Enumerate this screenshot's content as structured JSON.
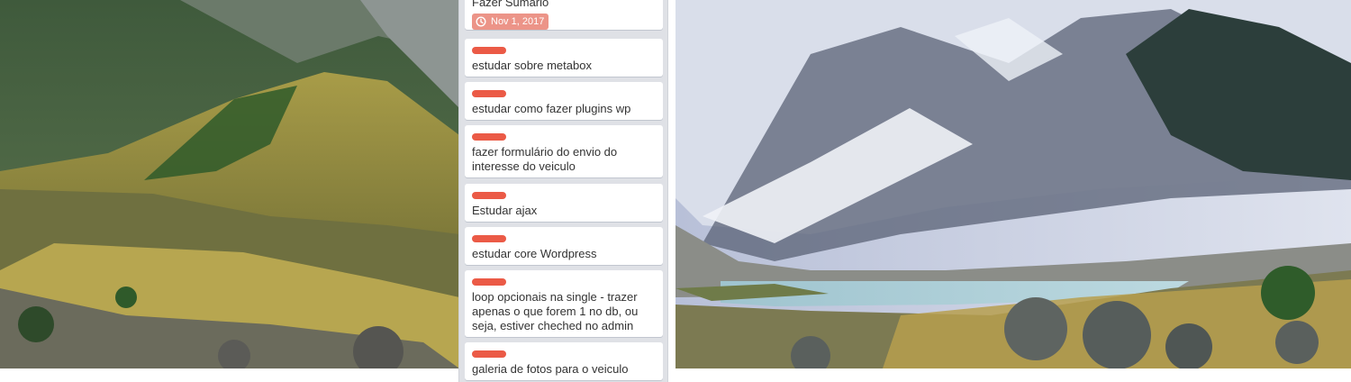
{
  "board": {
    "background": "mountain-lake-photo",
    "accent_label_color": "#eb5a46",
    "due_badge_color": "#ec9488"
  },
  "list": {
    "cards": [
      {
        "title": "Fazer Sumário",
        "label_color": "",
        "due": "Nov 1, 2017",
        "due_icon": "clock-icon"
      },
      {
        "title": "estudar sobre metabox",
        "label_color": "red"
      },
      {
        "title": "estudar como fazer plugins wp",
        "label_color": "red"
      },
      {
        "title": "fazer formulário do envio do interesse do veiculo",
        "label_color": "red"
      },
      {
        "title": "Estudar ajax",
        "label_color": "red"
      },
      {
        "title": "estudar core Wordpress",
        "label_color": "red"
      },
      {
        "title": "loop opcionais na single - trazer apenas o que forem 1 no db, ou seja, estiver cheched no admin",
        "label_color": "red"
      },
      {
        "title": "galeria de fotos para o veiculo",
        "label_color": "red"
      }
    ]
  }
}
